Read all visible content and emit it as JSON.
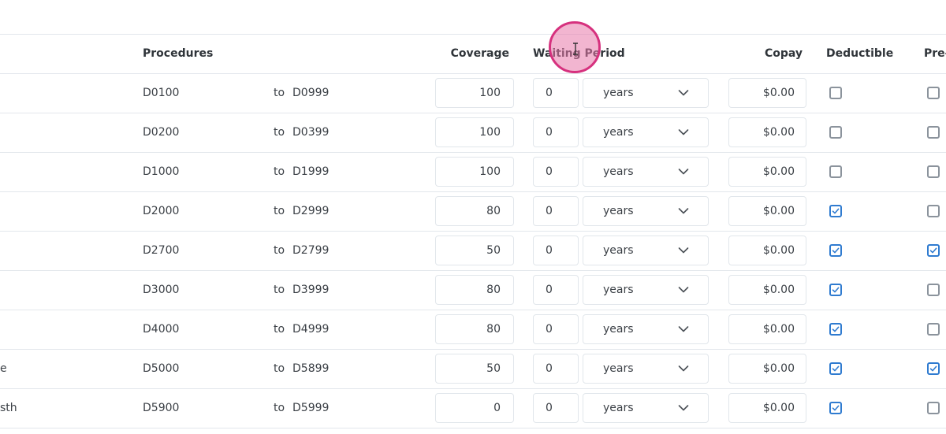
{
  "headers": {
    "procedures": "Procedures",
    "coverage": "Coverage",
    "waiting_period": "Waiting Period",
    "copay": "Copay",
    "deductible": "Deductible",
    "pre": "Pre-"
  },
  "to_label": "to",
  "rows": [
    {
      "category": "",
      "from": "D0100",
      "to": "D0999",
      "coverage": "100",
      "waiting": "0",
      "unit": "years",
      "copay": "$0.00",
      "deductible": false,
      "pre": false
    },
    {
      "category": "",
      "from": "D0200",
      "to": "D0399",
      "coverage": "100",
      "waiting": "0",
      "unit": "years",
      "copay": "$0.00",
      "deductible": false,
      "pre": false
    },
    {
      "category": "",
      "from": "D1000",
      "to": "D1999",
      "coverage": "100",
      "waiting": "0",
      "unit": "years",
      "copay": "$0.00",
      "deductible": false,
      "pre": false
    },
    {
      "category": "",
      "from": "D2000",
      "to": "D2999",
      "coverage": "80",
      "waiting": "0",
      "unit": "years",
      "copay": "$0.00",
      "deductible": true,
      "pre": false
    },
    {
      "category": "",
      "from": "D2700",
      "to": "D2799",
      "coverage": "50",
      "waiting": "0",
      "unit": "years",
      "copay": "$0.00",
      "deductible": true,
      "pre": true
    },
    {
      "category": "",
      "from": "D3000",
      "to": "D3999",
      "coverage": "80",
      "waiting": "0",
      "unit": "years",
      "copay": "$0.00",
      "deductible": true,
      "pre": false
    },
    {
      "category": "",
      "from": "D4000",
      "to": "D4999",
      "coverage": "80",
      "waiting": "0",
      "unit": "years",
      "copay": "$0.00",
      "deductible": true,
      "pre": false
    },
    {
      "category": "e",
      "from": "D5000",
      "to": "D5899",
      "coverage": "50",
      "waiting": "0",
      "unit": "years",
      "copay": "$0.00",
      "deductible": true,
      "pre": true
    },
    {
      "category": "sth",
      "from": "D5900",
      "to": "D5999",
      "coverage": "0",
      "waiting": "0",
      "unit": "years",
      "copay": "$0.00",
      "deductible": true,
      "pre": false
    }
  ],
  "icons": {
    "chevron": "chevron-down-icon",
    "cursor": "text-cursor-icon"
  },
  "colors": {
    "checkbox_checked": "#2f7bd0",
    "checkbox_unchecked": "#8b939c",
    "cursor_ring": "#d6317e"
  }
}
